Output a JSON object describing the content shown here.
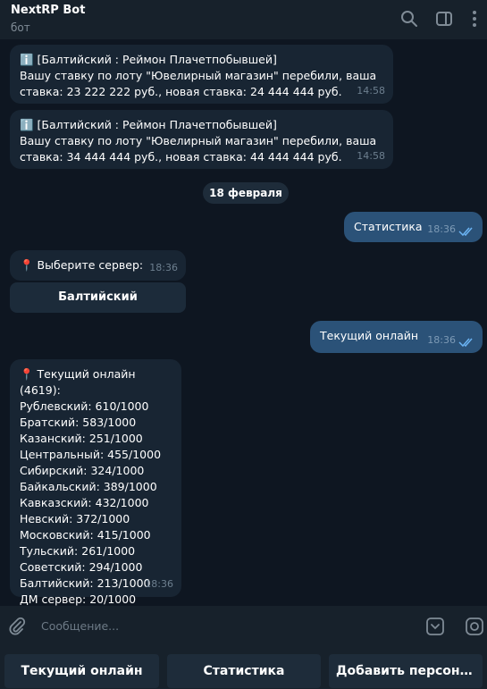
{
  "header": {
    "title": "NextRP Bot",
    "subtitle": "бот"
  },
  "messages": [
    {
      "text": "ℹ️ [Балтийский : Реймон Плачетпобывшей]\nВашу ставку по лоту \"Ювелирный магазин\" перебили, ваша\nставка: 23 222 222 руб., новая ставка: 24 444 444 руб.",
      "time": "14:58"
    },
    {
      "text": "ℹ️ [Балтийский : Реймон Плачетпобывшей]\nВашу ставку по лоту \"Ювелирный магазин\" перебили, ваша\nставка: 34 444 444 руб., новая ставка: 44 444 444 руб.",
      "time": "14:58"
    },
    {
      "text": "Статистика",
      "time": "18:36"
    },
    {
      "text": "📍 Выберите сервер:",
      "time": "18:36"
    },
    {
      "text": "Текущий онлайн",
      "time": "18:36"
    },
    {
      "text": "📍 Текущий онлайн (4619):\nРублевский: 610/1000\nБратский: 583/1000\nКазанский: 251/1000\nЦентральный: 455/1000\nСибирский: 324/1000\nБайкальский: 389/1000\nКавказский: 432/1000\nНевский: 372/1000\nМосковский: 415/1000\nТульский: 261/1000\nСоветский: 294/1000\nБалтийский: 213/1000\nДМ сервер: 20/1000",
      "time": "18:36"
    }
  ],
  "date_separator": "18 февраля",
  "inline_button": "Балтийский",
  "input": {
    "placeholder": "Сообщение..."
  },
  "keyboard": [
    "Текущий онлайн",
    "Статистика",
    "Добавить персонажа"
  ],
  "icons": {
    "header": [
      "search-icon",
      "sidebar-toggle-icon",
      "more-icon"
    ],
    "input": [
      "attach-icon",
      "keyboard-toggle-icon",
      "sticker-icon"
    ]
  },
  "colors": {
    "background": "#0e1621",
    "bubble_in": "#182533",
    "bubble_out": "#2b5278",
    "panel": "#17212b",
    "accent": "#6ab3f3"
  }
}
